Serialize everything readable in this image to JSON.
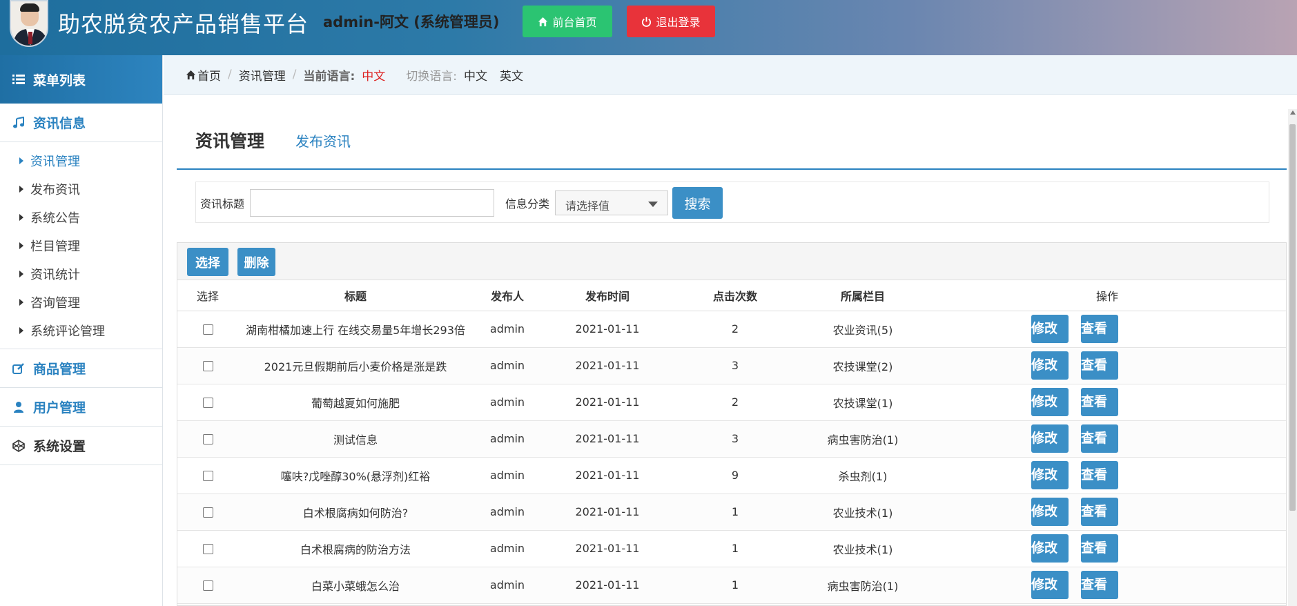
{
  "header": {
    "site_title": "助农脱贫农产品销售平台",
    "user_info": "admin-阿文 (系统管理员)",
    "home_button": "前台首页",
    "logout_button": "退出登录",
    "colors": {
      "home": "#2bc472",
      "logout": "#e8333a",
      "accent": "#2a82c0"
    }
  },
  "sidebar": {
    "menu_title": "菜单列表",
    "sections": [
      {
        "label": "资讯信息",
        "icon": "music-note-icon"
      },
      {
        "label": "商品管理",
        "icon": "edit-icon"
      },
      {
        "label": "用户管理",
        "icon": "user-icon"
      },
      {
        "label": "系统设置",
        "icon": "codepen-icon"
      }
    ],
    "items": [
      "资讯管理",
      "发布资讯",
      "系统公告",
      "栏目管理",
      "资讯统计",
      "咨询管理",
      "系统评论管理"
    ]
  },
  "breadcrumb": {
    "home": "首页",
    "current": "资讯管理",
    "lang_label": "当前语言:",
    "lang_value": "中文",
    "switch_label": "切换语言:",
    "lang_zh": "中文",
    "lang_en": "英文"
  },
  "main": {
    "title": "资讯管理",
    "link": "发布资讯",
    "search": {
      "title_label": "资讯标题",
      "title_value": "",
      "category_label": "信息分类",
      "category_selected": "请选择值",
      "search_button": "搜索"
    },
    "toolbar": {
      "select_button": "选择",
      "delete_button": "删除"
    },
    "table": {
      "columns": [
        "选择",
        "标题",
        "发布人",
        "发布时间",
        "点击次数",
        "所属栏目",
        "操作"
      ],
      "edit_label": "修改",
      "view_label": "查看",
      "rows": [
        {
          "title": "湖南柑橘加速上行 在线交易量5年增长293倍",
          "author": "admin",
          "date": "2021-01-11",
          "clicks": "2",
          "column": "农业资讯(5)"
        },
        {
          "title": "2021元旦假期前后小麦价格是涨是跌",
          "author": "admin",
          "date": "2021-01-11",
          "clicks": "3",
          "column": "农技课堂(2)"
        },
        {
          "title": "葡萄越夏如何施肥",
          "author": "admin",
          "date": "2021-01-11",
          "clicks": "2",
          "column": "农技课堂(1)"
        },
        {
          "title": "测试信息",
          "author": "admin",
          "date": "2021-01-11",
          "clicks": "3",
          "column": "病虫害防治(1)"
        },
        {
          "title": "噻呋?戊唑醇30%(悬浮剂)红裕",
          "author": "admin",
          "date": "2021-01-11",
          "clicks": "9",
          "column": "杀虫剂(1)"
        },
        {
          "title": "白术根腐病如何防治?",
          "author": "admin",
          "date": "2021-01-11",
          "clicks": "1",
          "column": "农业技术(1)"
        },
        {
          "title": "白术根腐病的防治方法",
          "author": "admin",
          "date": "2021-01-11",
          "clicks": "1",
          "column": "农业技术(1)"
        },
        {
          "title": "白菜小菜蛾怎么治",
          "author": "admin",
          "date": "2021-01-11",
          "clicks": "1",
          "column": "病虫害防治(1)"
        }
      ]
    }
  }
}
